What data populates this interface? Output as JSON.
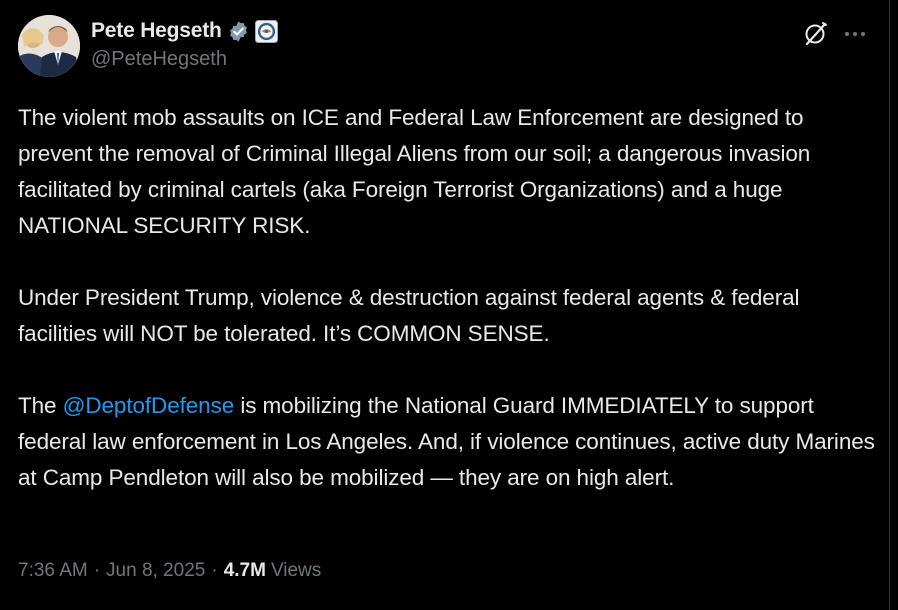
{
  "author": {
    "display_name": "Pete Hegseth",
    "handle": "@PeteHegseth",
    "verified_color": "#829aab"
  },
  "tweet": {
    "paragraphs": [
      {
        "text": "The violent mob assaults on ICE and Federal Law Enforcement are designed to prevent the removal of Criminal Illegal Aliens from our soil; a dangerous invasion facilitated by criminal cartels (aka Foreign Terrorist Organizations) and a huge NATIONAL SECURITY RISK."
      },
      {
        "text": "Under President Trump, violence & destruction against federal agents & federal facilities will NOT be tolerated. It’s COMMON SENSE."
      },
      {
        "prefix": "The ",
        "mention": "@DeptofDefense",
        "suffix": " is mobilizing the National Guard IMMEDIATELY to support federal law enforcement in Los Angeles. And, if violence continues, active duty Marines at Camp Pendleton will also be mobilized — they are on high alert."
      }
    ]
  },
  "meta": {
    "time": "7:36 AM",
    "separator": "·",
    "date": "Jun 8, 2025",
    "views_count": "4.7M",
    "views_label": "Views"
  },
  "icons": {
    "verified": "verified-badge-icon",
    "affiliation": "dod-seal-icon",
    "grok": "grok-icon",
    "more": "more-icon"
  },
  "colors": {
    "background": "#000000",
    "text": "#e7e9ea",
    "secondary": "#71767b",
    "link": "#1d9bf0"
  }
}
